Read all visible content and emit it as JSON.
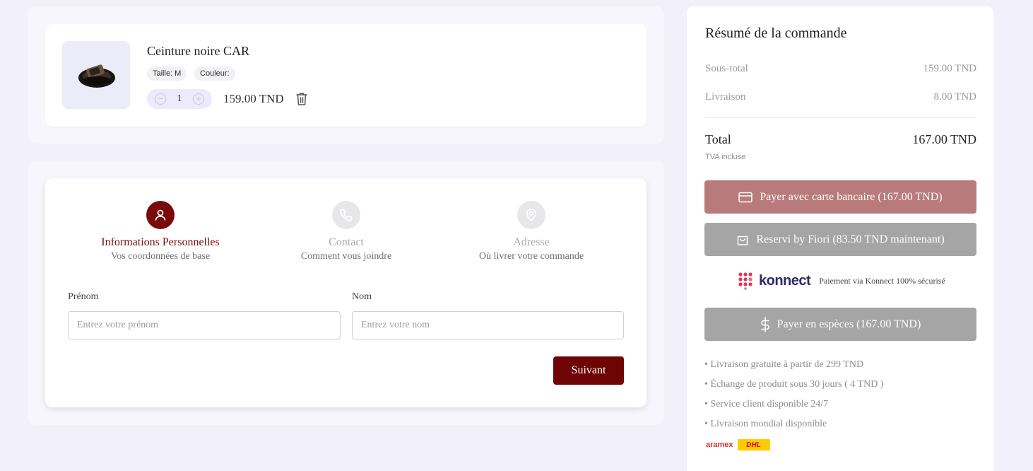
{
  "cart": {
    "product_name": "Ceinture noire CAR",
    "size_tag": "Taille: M",
    "color_tag": "Couleur:",
    "quantity": "1",
    "minus_symbol": "−",
    "plus_symbol": "+",
    "price": "159.00 TND",
    "icons": {
      "product": "belt-image",
      "delete": "trash-icon"
    }
  },
  "form": {
    "steps": [
      {
        "title": "Informations Personnelles",
        "subtitle": "Vos coordonnées de base",
        "icon": "user-icon",
        "active": true
      },
      {
        "title": "Contact",
        "subtitle": "Comment vous joindre",
        "icon": "phone-icon",
        "active": false
      },
      {
        "title": "Adresse",
        "subtitle": "Où livrer votre commande",
        "icon": "map-pin-icon",
        "active": false
      }
    ],
    "prenom_label": "Prénom",
    "prenom_placeholder": "Entrez votre prénom",
    "nom_label": "Nom",
    "nom_placeholder": "Entrez votre nom",
    "next_label": "Suivant"
  },
  "summary": {
    "title": "Résumé de la commande",
    "subtotal_label": "Sous-total",
    "subtotal_value": "159.00 TND",
    "shipping_label": "Livraison",
    "shipping_value": "8.00 TND",
    "total_label": "Total",
    "total_value": "167.00 TND",
    "tva_note": "TVA incluse",
    "card_pay_label": "Payer avec carte bancaire (167.00 TND)",
    "reservi_label": "Reservi by Fiori (83.50 TND maintenant)",
    "konnect_brand": "konnect",
    "konnect_text": "Paiement via Konnect 100% sécurisé",
    "cash_label": "Payer en espèces (167.00 TND)",
    "features": [
      "• Livraison gratuite à partir de 299 TND",
      "• Échange de produit sous 30 jours ( 4 TND )",
      "• Service client disponible 24/7",
      "• Livraison mondial disponible"
    ],
    "carrier_aramex": "aramex",
    "carrier_dhl": "DHL"
  },
  "colors": {
    "brand_maroon": "#6e0404",
    "card_button": "#b87a7a",
    "reservi_button": "#a5a5a5",
    "cash_button": "#a5a5a5",
    "background": "#f1f0fb"
  }
}
